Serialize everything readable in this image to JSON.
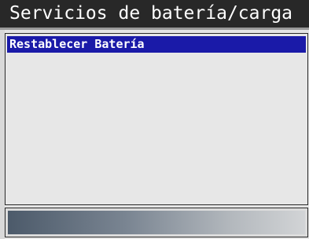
{
  "screen": {
    "title": "Servicios de batería/carga"
  },
  "menu": {
    "items": [
      {
        "label": "Restablecer Batería",
        "selected": true
      }
    ]
  },
  "colors": {
    "title_background": "#282828",
    "title_text": "#ffffff",
    "selection_background": "#1a1aa8",
    "panel_background": "#e7e7e7"
  }
}
